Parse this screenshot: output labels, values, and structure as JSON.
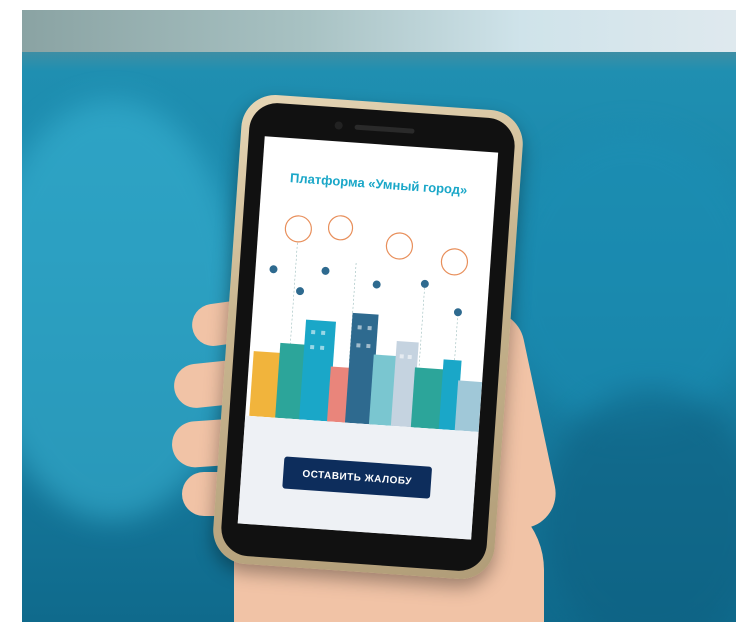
{
  "screen": {
    "title": "Платформа «Умный город»",
    "cta_label": "ОСТАВИТЬ ЖАЛОБУ",
    "brand_color": "#1aa7c8",
    "cta_color": "#0d2d5c"
  }
}
